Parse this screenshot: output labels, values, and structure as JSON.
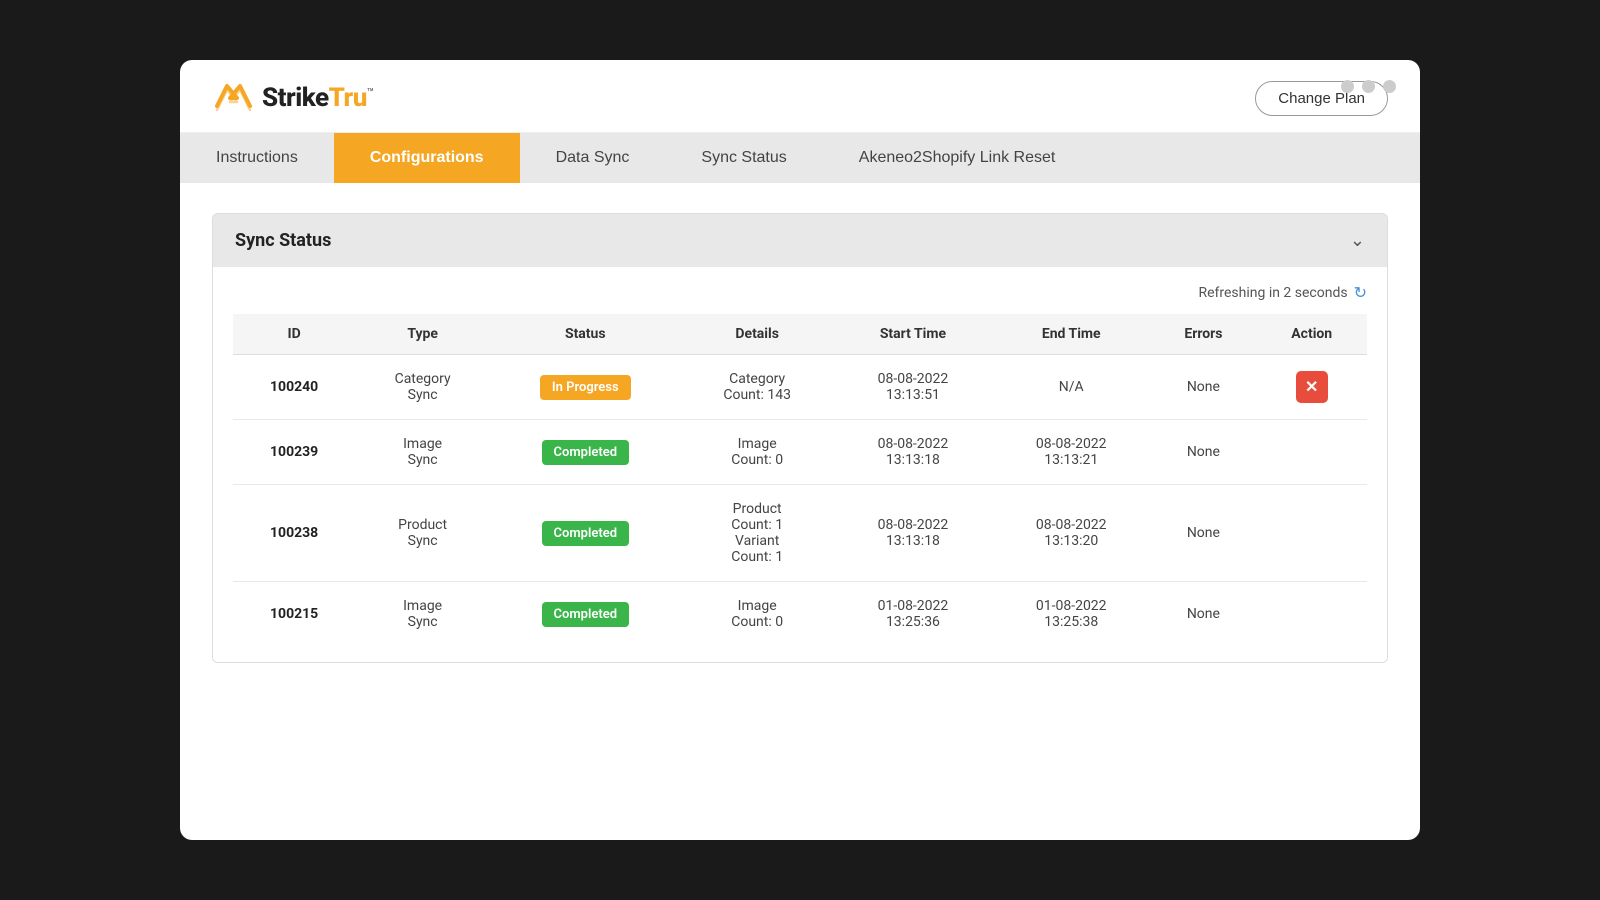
{
  "window": {
    "dots": [
      "dot1",
      "dot2",
      "dot3"
    ]
  },
  "header": {
    "logo_text_strike": "Strike",
    "logo_text_tru": "Tru",
    "logo_trademark": "™",
    "change_plan_label": "Change Plan"
  },
  "nav": {
    "tabs": [
      {
        "id": "instructions",
        "label": "Instructions",
        "active": false
      },
      {
        "id": "configurations",
        "label": "Configurations",
        "active": true
      },
      {
        "id": "data-sync",
        "label": "Data Sync",
        "active": false
      },
      {
        "id": "sync-status",
        "label": "Sync Status",
        "active": false
      },
      {
        "id": "link-reset",
        "label": "Akeneo2Shopify Link Reset",
        "active": false
      }
    ]
  },
  "sync_status_panel": {
    "title": "Sync Status",
    "chevron": "⌄",
    "refresh_text": "Refreshing in 2 seconds",
    "refresh_icon": "↻",
    "table": {
      "headers": [
        "ID",
        "Type",
        "Status",
        "Details",
        "Start Time",
        "End Time",
        "Errors",
        "Action"
      ],
      "rows": [
        {
          "id": "100240",
          "type": "Category\nSync",
          "status": "In Progress",
          "status_type": "in-progress",
          "details": "Category\nCount: 143",
          "start_time": "08-08-2022\n13:13:51",
          "end_time": "N/A",
          "errors": "None",
          "has_action": true,
          "action_icon": "✕"
        },
        {
          "id": "100239",
          "type": "Image\nSync",
          "status": "Completed",
          "status_type": "completed",
          "details": "Image\nCount: 0",
          "start_time": "08-08-2022\n13:13:18",
          "end_time": "08-08-2022\n13:13:21",
          "errors": "None",
          "has_action": false,
          "action_icon": ""
        },
        {
          "id": "100238",
          "type": "Product\nSync",
          "status": "Completed",
          "status_type": "completed",
          "details": "Product\nCount: 1\nVariant\nCount: 1",
          "start_time": "08-08-2022\n13:13:18",
          "end_time": "08-08-2022\n13:13:20",
          "errors": "None",
          "has_action": false,
          "action_icon": ""
        },
        {
          "id": "100215",
          "type": "Image\nSync",
          "status": "Completed",
          "status_type": "completed",
          "details": "Image\nCount: 0",
          "start_time": "01-08-2022\n13:25:36",
          "end_time": "01-08-2022\n13:25:38",
          "errors": "None",
          "has_action": false,
          "action_icon": ""
        }
      ]
    }
  }
}
